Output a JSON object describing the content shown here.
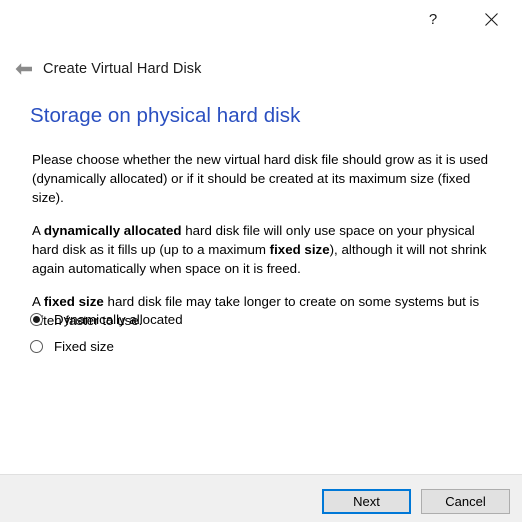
{
  "window": {
    "help_label": "?",
    "close_label": "×",
    "back_label": "←"
  },
  "wizard": {
    "title": "Create Virtual Hard Disk",
    "heading": "Storage on physical hard disk",
    "heading_color": "#2a4fc0"
  },
  "body": {
    "paragraph_1": "Please choose whether the new virtual hard disk file should grow as it is used (dynamically allocated) or if it should be created at its maximum size (fixed size).",
    "paragraph_2": {
      "part_1": "A ",
      "bold_1": "dynamically allocated",
      "part_2": " hard disk file will only use space on your physical hard disk as it fills up (up to a maximum ",
      "bold_2": "fixed size",
      "part_3": "), although it will not shrink again automatically when space on it is freed."
    },
    "paragraph_3": {
      "part_1": "A ",
      "bold_1": "fixed size",
      "part_2": " hard disk file may take longer to create on some systems but is often faster to use."
    }
  },
  "options": {
    "items": [
      {
        "label": "Dynamically allocated",
        "selected": true
      },
      {
        "label": "Fixed size",
        "selected": false
      }
    ]
  },
  "footer": {
    "next_label": "Next",
    "cancel_label": "Cancel",
    "focus_color": "#0078d7"
  }
}
